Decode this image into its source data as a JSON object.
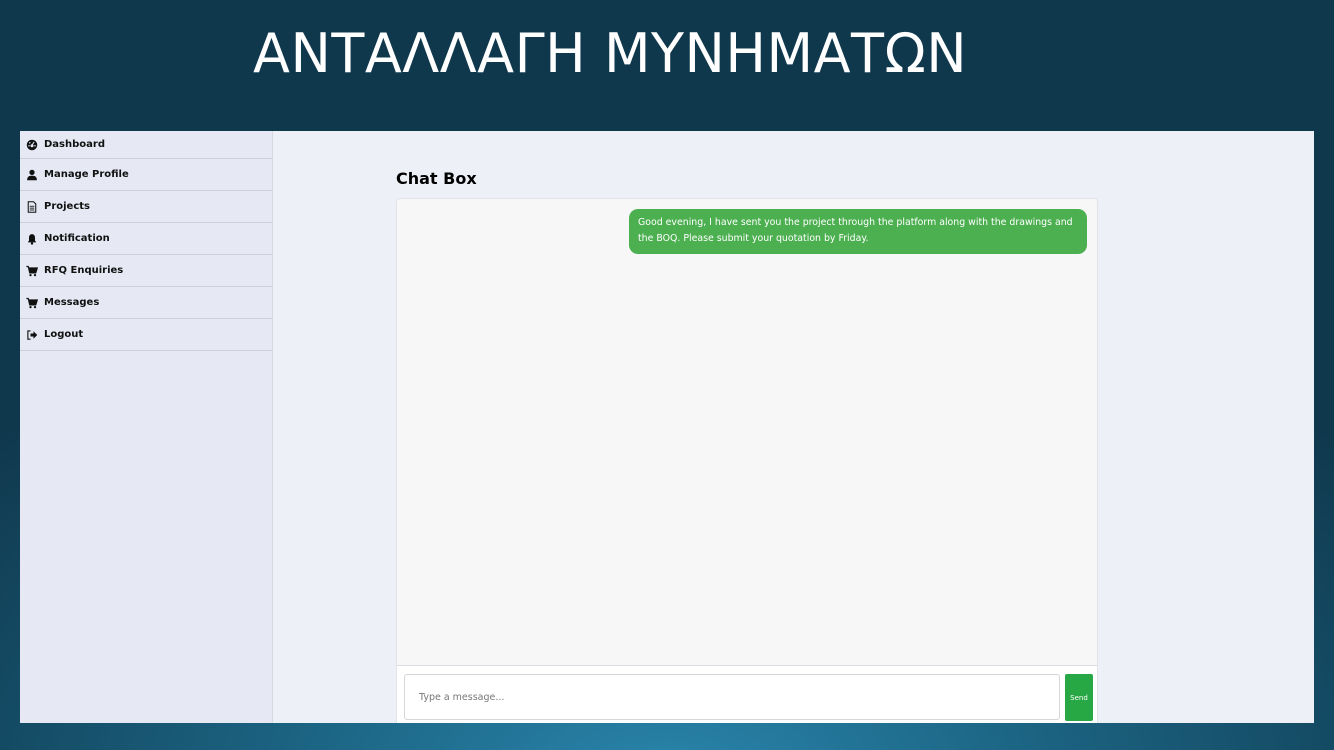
{
  "slide": {
    "title": "ΑΝΤΑΛΛΑΓΗ ΜΥΝΗΜΑΤΩΝ"
  },
  "sidebar": {
    "items": [
      {
        "label": "Dashboard",
        "icon": "dashboard-icon"
      },
      {
        "label": "Manage Profile",
        "icon": "user-icon"
      },
      {
        "label": "Projects",
        "icon": "document-icon"
      },
      {
        "label": "Notification",
        "icon": "bell-icon"
      },
      {
        "label": "RFQ Enquiries",
        "icon": "cart-icon"
      },
      {
        "label": "Messages",
        "icon": "cart-icon"
      },
      {
        "label": "Logout",
        "icon": "logout-icon"
      }
    ]
  },
  "chat": {
    "title": "Chat Box",
    "messages": [
      {
        "direction": "sent",
        "text": "Good evening, I have sent you the project through the platform along with the drawings and the BOQ. Please submit your quotation by Friday."
      }
    ],
    "input": {
      "placeholder": "Type a message...",
      "value": ""
    },
    "send_label": "Send"
  },
  "colors": {
    "bubble": "#4caf50",
    "send_button": "#28a745",
    "background_dark": "#10384d",
    "background_light": "#2a86ad"
  }
}
